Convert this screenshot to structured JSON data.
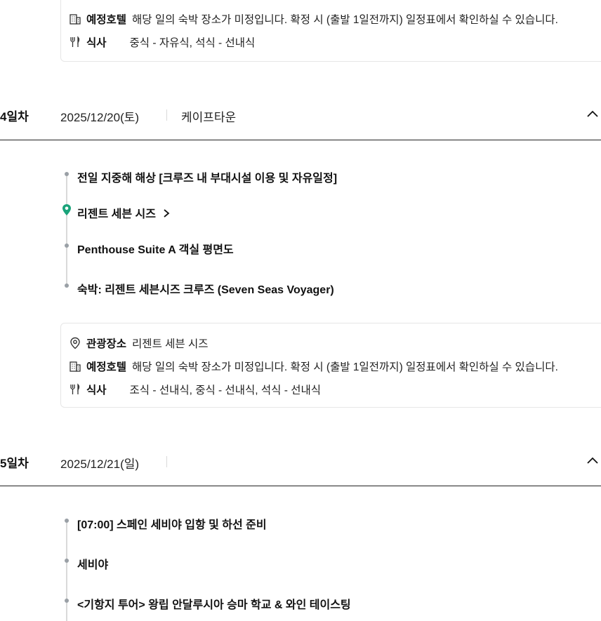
{
  "day3_summary": {
    "hotel_label": "예정호텔",
    "hotel_text": "해당 일의 숙박 장소가 미정입니다. 확정 시 (출발 1일전까지) 일정표에서 확인하실 수 있습니다.",
    "meal_label": "식사",
    "meal_text": "중식 - 자유식, 석식 - 선내식"
  },
  "day4": {
    "label": "4일차",
    "date": "2025/12/20(토)",
    "city": "케이프타운",
    "items": [
      "전일 지중해 해상 [크루즈 내 부대시설 이용 및 자유일정]",
      "리젠트 세븐 시즈",
      "Penthouse Suite A 객실 평면도",
      "숙박: 리젠트 세븐시즈 크루즈 (Seven Seas Voyager)"
    ],
    "summary": {
      "place_label": "관광장소",
      "place_text": "리젠트 세븐 시즈",
      "hotel_label": "예정호텔",
      "hotel_text": "해당 일의 숙박 장소가 미정입니다. 확정 시 (출발 1일전까지) 일정표에서 확인하실 수 있습니다.",
      "meal_label": "식사",
      "meal_text": "조식 - 선내식, 중식 - 선내식, 석식 - 선내식"
    }
  },
  "day5": {
    "label": "5일차",
    "date": "2025/12/21(일)",
    "items": [
      "[07:00] 스페인 세비야 입항 및 하선 준비",
      "세비야",
      "<기항지 투어> 왕립 안달루시아 승마 학교 & 와인 테이스팅"
    ]
  },
  "icons": {
    "hotel": "hotel-building-icon",
    "meal": "fork-knife-icon",
    "place": "location-pin-outline-icon",
    "spot": "location-pin-filled-icon",
    "collapse": "chevron-up-icon"
  },
  "colors": {
    "pin": "#1aa37a",
    "dot": "#9aa0a6",
    "line": "#d9d9d9"
  }
}
